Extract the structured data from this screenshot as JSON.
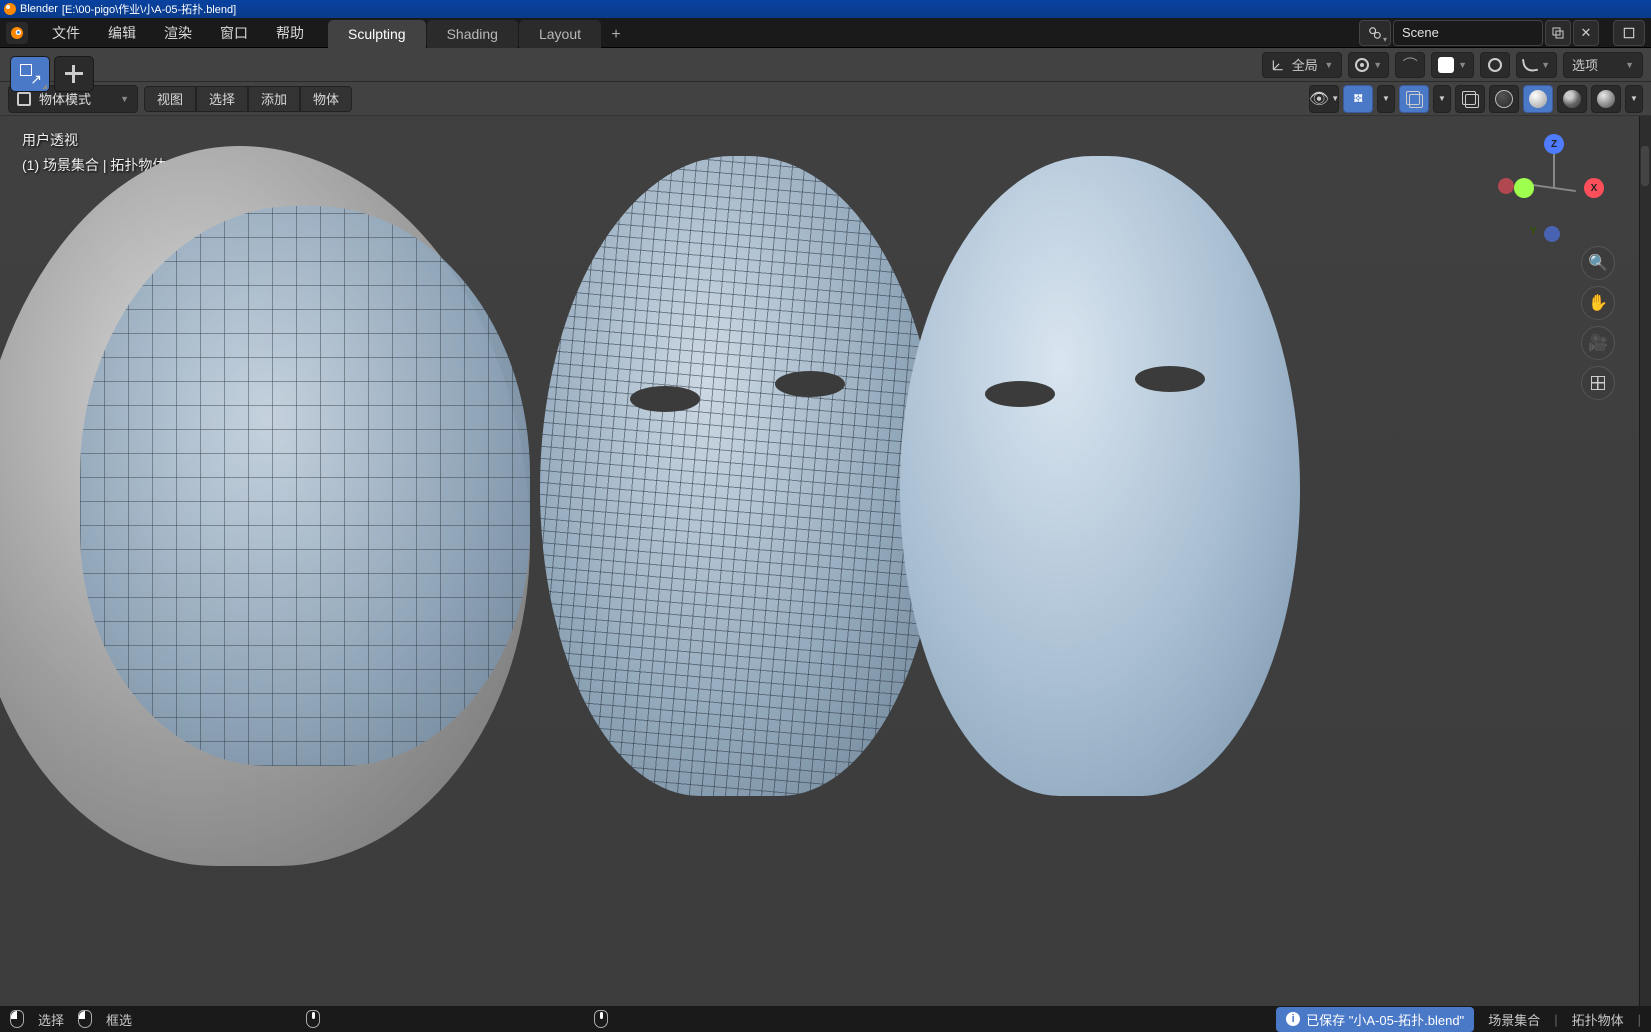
{
  "titlebar": {
    "app": "Blender",
    "path": "[E:\\00-pigo\\作业\\小A-05-拓扑.blend]"
  },
  "menu": {
    "file": "文件",
    "edit": "编辑",
    "render": "渲染",
    "window": "窗口",
    "help": "帮助"
  },
  "workspaces": {
    "items": [
      "Sculpting",
      "Shading",
      "Layout"
    ],
    "active": 0,
    "add": "+"
  },
  "scene": {
    "name": "Scene"
  },
  "header": {
    "transform_orientation": "全局",
    "options_label": "选项"
  },
  "mode_row": {
    "mode": "物体模式",
    "menus": {
      "view": "视图",
      "select": "选择",
      "add": "添加",
      "object": "物体"
    }
  },
  "viewport_info": {
    "line1": "用户透视",
    "line2": "(1) 场景集合 | 拓扑物体"
  },
  "gizmo": {
    "x": "X",
    "y": "Y",
    "z": "Z"
  },
  "statusbar": {
    "select": "选择",
    "box_select": "框选",
    "saved_msg": "已保存 \"小A-05-拓扑.blend\"",
    "collection": "场景集合",
    "object": "拓扑物体"
  }
}
